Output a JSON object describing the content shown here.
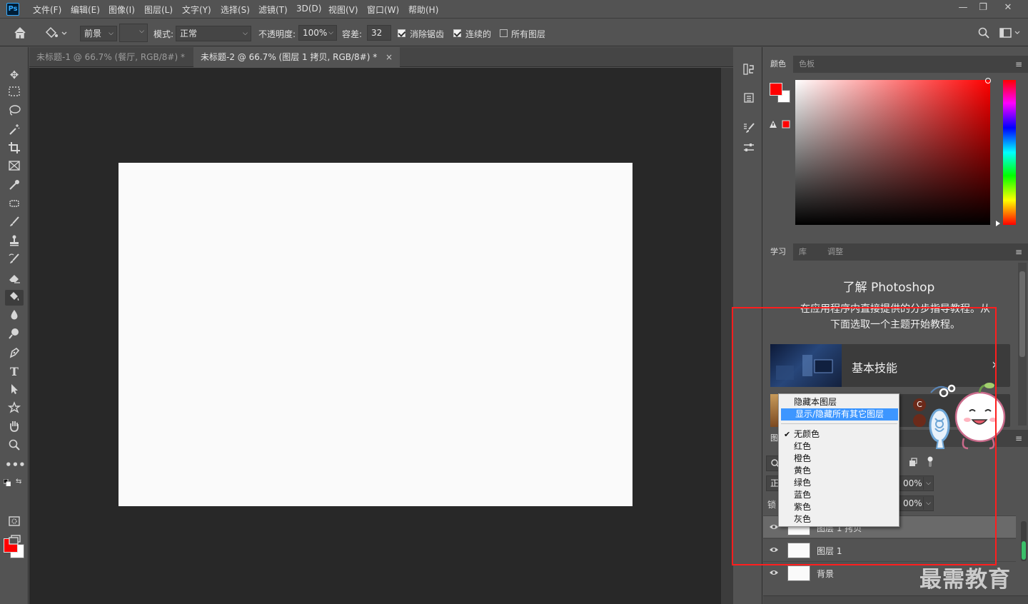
{
  "app": {
    "logo": "Ps"
  },
  "menu": [
    "文件(F)",
    "编辑(E)",
    "图像(I)",
    "图层(L)",
    "文字(Y)",
    "选择(S)",
    "滤镜(T)",
    "3D(D)",
    "视图(V)",
    "窗口(W)",
    "帮助(H)"
  ],
  "window_controls": {
    "minimize": "—",
    "restore": "❐",
    "close": "✕"
  },
  "options": {
    "fill_source": "前景",
    "mode_label": "模式:",
    "mode_value": "正常",
    "opacity_label": "不透明度:",
    "opacity_value": "100%",
    "tolerance_label": "容差:",
    "tolerance_value": "32",
    "antialias_label": "消除锯齿",
    "antialias_checked": true,
    "contiguous_label": "连续的",
    "contiguous_checked": true,
    "all_layers_label": "所有图层",
    "all_layers_checked": false
  },
  "document_tabs": [
    {
      "label": "未标题-1 @ 66.7% (餐厅, RGB/8#) *",
      "active": false
    },
    {
      "label": "未标题-2 @ 66.7% (图层 1 拷贝, RGB/8#) *",
      "active": true
    }
  ],
  "tab_close": "×",
  "colors": {
    "foreground": "#ff0000",
    "background": "#ffffff",
    "highlight": "#3d96ff",
    "annotation_box": "#ff1e1e"
  },
  "color_panel": {
    "tabs": [
      "颜色",
      "色板"
    ]
  },
  "learn_panel": {
    "tabs": [
      "学习",
      "库",
      "调整"
    ],
    "title": "了解 Photoshop",
    "desc_line1": "在应用程序内直接提供的分步指导教程。从",
    "desc_line2": "下面选取一个主题开始教程。",
    "card1": "基本技能",
    "card_arrow": "›"
  },
  "context_menu": {
    "items_top": [
      "隐藏本图层",
      "显示/隐藏所有其它图层"
    ],
    "highlighted_index": 1,
    "colors": [
      "无颜色",
      "红色",
      "橙色",
      "黄色",
      "绿色",
      "蓝色",
      "紫色",
      "灰色"
    ],
    "checked_color": "无颜色",
    "tick": "✔"
  },
  "layers_panel": {
    "tab_partial": "图",
    "opacity_partial": "00%",
    "fill_partial": "00%",
    "mode_partial": "正",
    "lock_partial": "锁",
    "layers": [
      "图层 1 拷贝",
      "图层 1",
      "背景"
    ]
  },
  "watermark": "最需教育"
}
